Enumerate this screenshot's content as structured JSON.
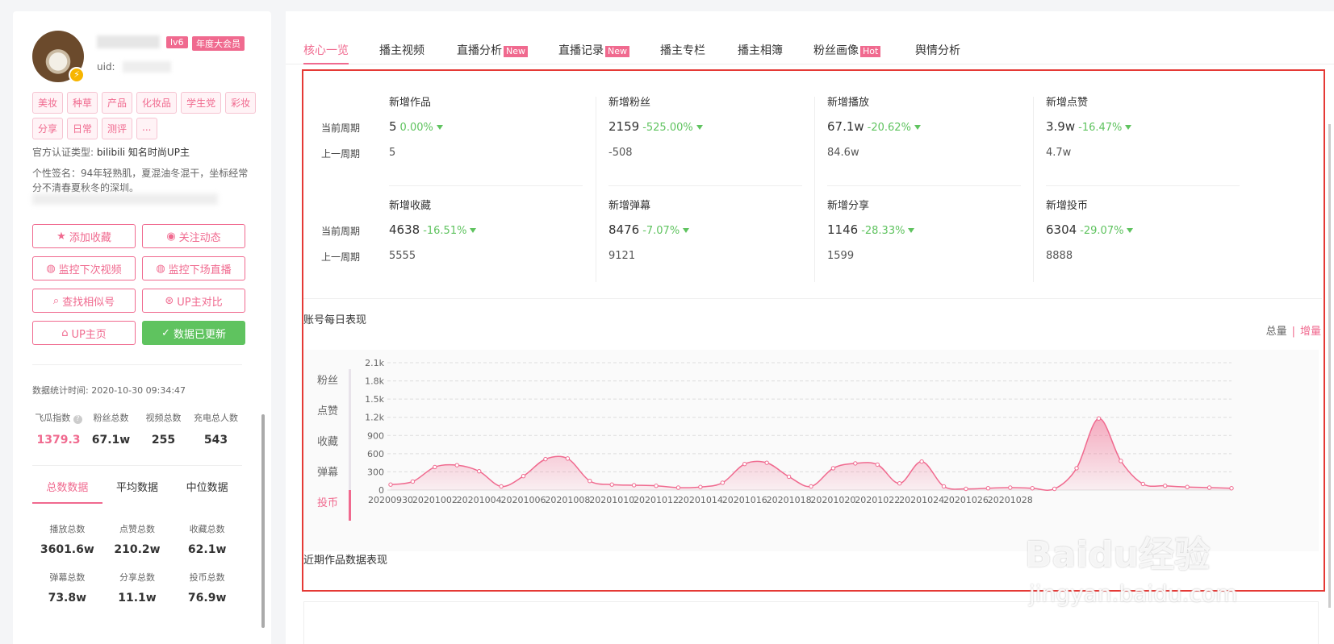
{
  "profile": {
    "level": "lv6",
    "vip": "年度大会员",
    "uid_label": "uid:",
    "tags": [
      "美妆",
      "种草",
      "产品",
      "化妆品",
      "学生党",
      "彩妆",
      "分享",
      "日常",
      "测评",
      "..."
    ],
    "cert_label": "官方认证类型:",
    "cert_value": "bilibili 知名时尚UP主",
    "signature": "个性签名：94年轻熟肌，夏混油冬混干，坐标经常分不清春夏秋冬的深圳。"
  },
  "actions": [
    {
      "label": "添加收藏",
      "icon": "star-icon"
    },
    {
      "label": "关注动态",
      "icon": "eye-icon"
    },
    {
      "label": "监控下次视频",
      "icon": "monitor-icon"
    },
    {
      "label": "监控下场直播",
      "icon": "monitor-icon"
    },
    {
      "label": "查找相似号",
      "icon": "search-icon"
    },
    {
      "label": "UP主对比",
      "icon": "compare-icon"
    },
    {
      "label": "UP主页",
      "icon": "home-icon"
    },
    {
      "label": "数据已更新",
      "icon": "check-icon"
    }
  ],
  "stats": {
    "time_label": "数据统计时间:",
    "time_value": "2020-10-30 09:34:47",
    "kpis": [
      {
        "label": "飞瓜指数",
        "value": "1379.3"
      },
      {
        "label": "粉丝总数",
        "value": "67.1w"
      },
      {
        "label": "视频总数",
        "value": "255"
      },
      {
        "label": "充电总人数",
        "value": "543"
      }
    ],
    "tabs": [
      "总数数据",
      "平均数据",
      "中位数据"
    ],
    "totals": [
      {
        "label": "播放总数",
        "value": "3601.6w"
      },
      {
        "label": "点赞总数",
        "value": "210.2w"
      },
      {
        "label": "收藏总数",
        "value": "62.1w"
      },
      {
        "label": "弹幕总数",
        "value": "73.8w"
      },
      {
        "label": "分享总数",
        "value": "11.1w"
      },
      {
        "label": "投币总数",
        "value": "76.9w"
      }
    ]
  },
  "nav": {
    "tabs": [
      {
        "label": "核心一览",
        "badge": ""
      },
      {
        "label": "播主视频",
        "badge": ""
      },
      {
        "label": "直播分析",
        "badge": "New"
      },
      {
        "label": "直播记录",
        "badge": "New"
      },
      {
        "label": "播主专栏",
        "badge": ""
      },
      {
        "label": "播主相簿",
        "badge": ""
      },
      {
        "label": "粉丝画像",
        "badge": "Hot"
      },
      {
        "label": "舆情分析",
        "badge": ""
      }
    ]
  },
  "overview": {
    "row_current": "当前周期",
    "row_previous": "上一周期",
    "metrics": [
      {
        "title": "新增作品",
        "current": "5",
        "change": "0.00%",
        "previous": "5"
      },
      {
        "title": "新增粉丝",
        "current": "2159",
        "change": "-525.00%",
        "previous": "-508"
      },
      {
        "title": "新增播放",
        "current": "67.1w",
        "change": "-20.62%",
        "previous": "84.6w"
      },
      {
        "title": "新增点赞",
        "current": "3.9w",
        "change": "-16.47%",
        "previous": "4.7w"
      },
      {
        "title": "新增收藏",
        "current": "4638",
        "change": "-16.51%",
        "previous": "5555"
      },
      {
        "title": "新增弹幕",
        "current": "8476",
        "change": "-7.07%",
        "previous": "9121"
      },
      {
        "title": "新增分享",
        "current": "1146",
        "change": "-28.33%",
        "previous": "1599"
      },
      {
        "title": "新增投币",
        "current": "6304",
        "change": "-29.07%",
        "previous": "8888"
      }
    ]
  },
  "daily": {
    "title": "账号每日表现",
    "toggle_total": "总量",
    "toggle_sep": "|",
    "toggle_incr": "增量",
    "legend": [
      "粉丝",
      "点赞",
      "收藏",
      "弹幕",
      "投币"
    ],
    "legend_active": "投币"
  },
  "recent_title": "近期作品数据表现",
  "watermark": {
    "line1": "Baidu经验",
    "line2": "jingyan.baidu.com"
  },
  "colors": {
    "accent": "#f06a8f",
    "green": "#5fc35f",
    "red_box": "#e53935"
  },
  "chart_data": {
    "type": "area",
    "series": [
      {
        "name": "投币",
        "values": [
          90,
          140,
          380,
          410,
          310,
          60,
          230,
          510,
          520,
          150,
          90,
          80,
          70,
          40,
          50,
          120,
          430,
          450,
          220,
          60,
          360,
          440,
          420,
          110,
          470,
          60,
          20,
          30,
          40,
          30,
          20,
          360,
          1180,
          480,
          100,
          70,
          50,
          40,
          30
        ]
      }
    ],
    "x_tick_labels": [
      "20200930",
      "20201002",
      "20201004",
      "20201006",
      "20201008",
      "20201010",
      "20201012",
      "20201014",
      "20201016",
      "20201018",
      "20201020",
      "20201022",
      "20201024",
      "20201026",
      "20201028"
    ],
    "y_ticks": [
      0,
      300,
      600,
      900,
      "1.2k",
      "1.5k",
      "1.8k",
      "2.1k"
    ],
    "ylim": [
      0,
      2100
    ],
    "grid": true,
    "color": "#f06a8f"
  }
}
